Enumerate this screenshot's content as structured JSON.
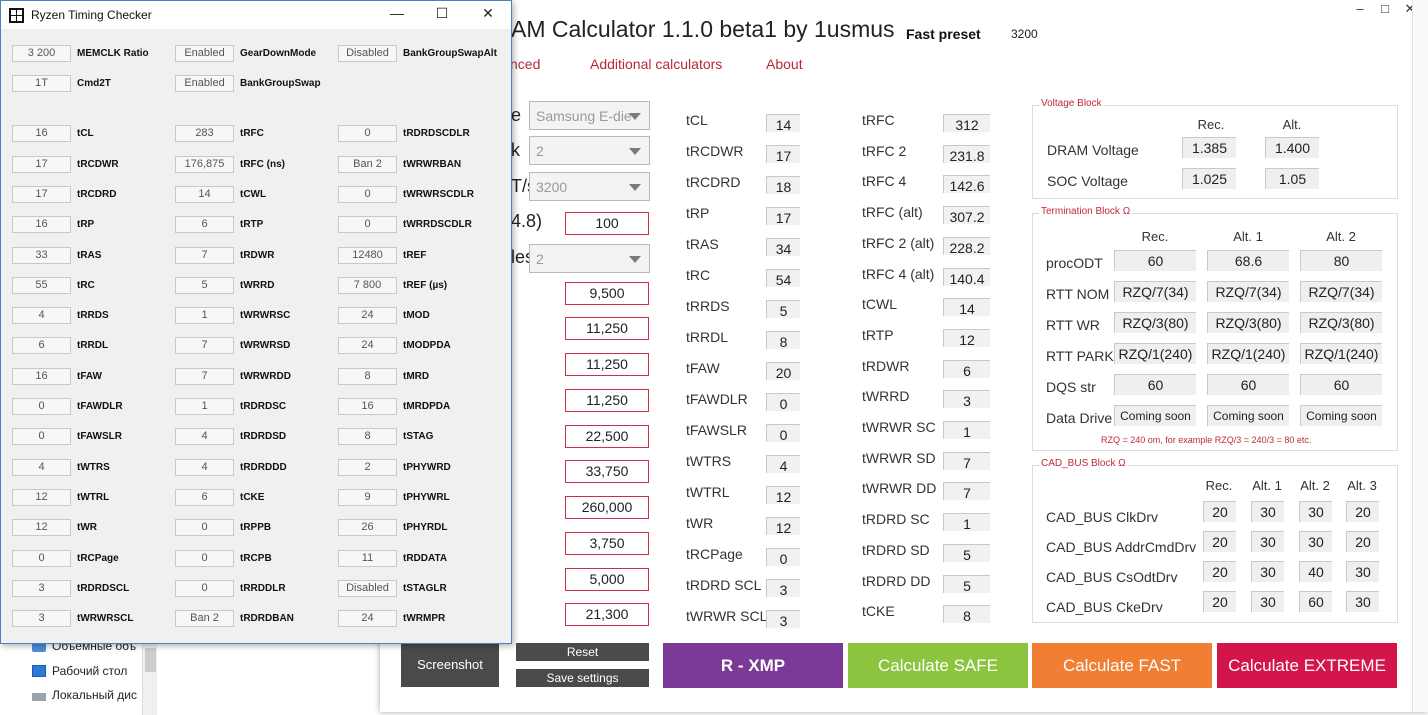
{
  "explorer": {
    "items": [
      "Объемные объ",
      "Рабочий стол",
      "Локальный дис"
    ]
  },
  "calculator": {
    "title": "AM Calculator 1.1.0 beta1 by 1usmus",
    "preset_label": "Fast preset",
    "preset_value": "3200",
    "window_buttons": [
      "–",
      "□",
      "✕"
    ],
    "nav": [
      "nced",
      "Additional calculators",
      "About"
    ],
    "left_labels": [
      "e",
      "k",
      "T/s)",
      "4.8)",
      "les"
    ],
    "combos": [
      "Samsung E-die",
      "2",
      "3200",
      "2"
    ],
    "red_values": [
      "100",
      "9,500",
      "11,250",
      "11,250",
      "11,250",
      "22,500",
      "33,750",
      "260,000",
      "3,750",
      "5,000",
      "21,300"
    ],
    "col1": [
      {
        "label": "tCL",
        "value": "14"
      },
      {
        "label": "tRCDWR",
        "value": "17"
      },
      {
        "label": "tRCDRD",
        "value": "18"
      },
      {
        "label": "tRP",
        "value": "17"
      },
      {
        "label": "tRAS",
        "value": "34"
      },
      {
        "label": "tRC",
        "value": "54"
      },
      {
        "label": "tRRDS",
        "value": "5"
      },
      {
        "label": "tRRDL",
        "value": "8"
      },
      {
        "label": "tFAW",
        "value": "20"
      },
      {
        "label": "tFAWDLR",
        "value": "0"
      },
      {
        "label": "tFAWSLR",
        "value": "0"
      },
      {
        "label": "tWTRS",
        "value": "4"
      },
      {
        "label": "tWTRL",
        "value": "12"
      },
      {
        "label": "tWR",
        "value": "12"
      },
      {
        "label": "tRCPage",
        "value": "0"
      },
      {
        "label": "tRDRD SCL",
        "value": "3"
      },
      {
        "label": "tWRWR SCL",
        "value": "3"
      }
    ],
    "col2": [
      {
        "label": "tRFC",
        "value": "312"
      },
      {
        "label": "tRFC 2",
        "value": "231.8"
      },
      {
        "label": "tRFC 4",
        "value": "142.6"
      },
      {
        "label": "tRFC (alt)",
        "value": "307.2"
      },
      {
        "label": "tRFC 2 (alt)",
        "value": "228.2"
      },
      {
        "label": "tRFC 4 (alt)",
        "value": "140.4"
      },
      {
        "label": "tCWL",
        "value": "14"
      },
      {
        "label": "tRTP",
        "value": "12"
      },
      {
        "label": "tRDWR",
        "value": "6"
      },
      {
        "label": "tWRRD",
        "value": "3"
      },
      {
        "label": "tWRWR SC",
        "value": "1"
      },
      {
        "label": "tWRWR SD",
        "value": "7"
      },
      {
        "label": "tWRWR DD",
        "value": "7"
      },
      {
        "label": "tRDRD SC",
        "value": "1"
      },
      {
        "label": "tRDRD SD",
        "value": "5"
      },
      {
        "label": "tRDRD DD",
        "value": "5"
      },
      {
        "label": "tCKE",
        "value": "8"
      }
    ],
    "voltage": {
      "title": "Voltage Block",
      "headers": [
        "Rec.",
        "Alt."
      ],
      "rows": [
        {
          "label": "DRAM Voltage",
          "values": [
            "1.385",
            "1.400"
          ]
        },
        {
          "label": "SOC Voltage",
          "values": [
            "1.025",
            "1.05"
          ]
        }
      ]
    },
    "termination": {
      "title": "Termination Block Ω",
      "headers": [
        "Rec.",
        "Alt. 1",
        "Alt. 2"
      ],
      "rows": [
        {
          "label": "procODT",
          "values": [
            "60",
            "68.6",
            "80"
          ]
        },
        {
          "label": "RTT NOM",
          "values": [
            "RZQ/7(34)",
            "RZQ/7(34)",
            "RZQ/7(34)"
          ]
        },
        {
          "label": "RTT WR",
          "values": [
            "RZQ/3(80)",
            "RZQ/3(80)",
            "RZQ/3(80)"
          ]
        },
        {
          "label": "RTT PARK",
          "values": [
            "RZQ/1(240)",
            "RZQ/1(240)",
            "RZQ/1(240)"
          ]
        },
        {
          "label": "DQS str",
          "values": [
            "60",
            "60",
            "60"
          ]
        },
        {
          "label": "Data Drive",
          "values": [
            "Coming soon",
            "Coming soon",
            "Coming soon"
          ]
        }
      ],
      "note": "RZQ = 240 om, for example RZQ/3 = 240/3 = 80 etc."
    },
    "cadbus": {
      "title": "CAD_BUS Block Ω",
      "headers": [
        "Rec.",
        "Alt. 1",
        "Alt. 2",
        "Alt. 3"
      ],
      "rows": [
        {
          "label": "CAD_BUS ClkDrv",
          "values": [
            "20",
            "30",
            "30",
            "20"
          ]
        },
        {
          "label": "CAD_BUS AddrCmdDrv",
          "values": [
            "20",
            "30",
            "30",
            "20"
          ]
        },
        {
          "label": "CAD_BUS CsOdtDrv",
          "values": [
            "20",
            "30",
            "40",
            "30"
          ]
        },
        {
          "label": "CAD_BUS CkeDrv",
          "values": [
            "20",
            "30",
            "60",
            "30"
          ]
        }
      ]
    },
    "buttons": {
      "screenshot": "Screenshot",
      "reset": "Reset",
      "save": "Save settings",
      "xmp": "R - XMP",
      "safe": "Calculate SAFE",
      "fast": "Calculate FAST",
      "extreme": "Calculate EXTREME"
    },
    "colors": {
      "accent": "#c0293b",
      "xmp": "#7b3a98",
      "safe": "#8cc43f",
      "fast": "#f07f33",
      "extreme": "#d4154b",
      "dark": "#4a4a4a"
    }
  },
  "rtc": {
    "title": "Ryzen Timing Checker",
    "window_buttons": [
      "—",
      "☐",
      "✕"
    ],
    "rows": [
      [
        {
          "v": "3 200",
          "l": "MEMCLK Ratio"
        },
        {
          "v": "Enabled",
          "l": "GearDownMode"
        },
        {
          "v": "Disabled",
          "l": "BankGroupSwapAlt"
        }
      ],
      [
        {
          "v": "1T",
          "l": "Cmd2T"
        },
        {
          "v": "Enabled",
          "l": "BankGroupSwap"
        },
        null
      ],
      [
        {
          "v": "16",
          "l": "tCL"
        },
        {
          "v": "283",
          "l": "tRFC"
        },
        {
          "v": "0",
          "l": "tRDRDSCDLR"
        }
      ],
      [
        {
          "v": "17",
          "l": "tRCDWR"
        },
        {
          "v": "176,875",
          "l": "tRFC (ns)"
        },
        {
          "v": "Ban 2",
          "l": "tWRWRBAN"
        }
      ],
      [
        {
          "v": "17",
          "l": "tRCDRD"
        },
        {
          "v": "14",
          "l": "tCWL"
        },
        {
          "v": "0",
          "l": "tWRWRSCDLR"
        }
      ],
      [
        {
          "v": "16",
          "l": "tRP"
        },
        {
          "v": "6",
          "l": "tRTP"
        },
        {
          "v": "0",
          "l": "tWRRDSCDLR"
        }
      ],
      [
        {
          "v": "33",
          "l": "tRAS"
        },
        {
          "v": "7",
          "l": "tRDWR"
        },
        {
          "v": "12480",
          "l": "tREF"
        }
      ],
      [
        {
          "v": "55",
          "l": "tRC"
        },
        {
          "v": "5",
          "l": "tWRRD"
        },
        {
          "v": "7 800",
          "l": "tREF (µs)"
        }
      ],
      [
        {
          "v": "4",
          "l": "tRRDS"
        },
        {
          "v": "1",
          "l": "tWRWRSC"
        },
        {
          "v": "24",
          "l": "tMOD"
        }
      ],
      [
        {
          "v": "6",
          "l": "tRRDL"
        },
        {
          "v": "7",
          "l": "tWRWRSD"
        },
        {
          "v": "24",
          "l": "tMODPDA"
        }
      ],
      [
        {
          "v": "16",
          "l": "tFAW"
        },
        {
          "v": "7",
          "l": "tWRWRDD"
        },
        {
          "v": "8",
          "l": "tMRD"
        }
      ],
      [
        {
          "v": "0",
          "l": "tFAWDLR"
        },
        {
          "v": "1",
          "l": "tRDRDSC"
        },
        {
          "v": "16",
          "l": "tMRDPDA"
        }
      ],
      [
        {
          "v": "0",
          "l": "tFAWSLR"
        },
        {
          "v": "4",
          "l": "tRDRDSD"
        },
        {
          "v": "8",
          "l": "tSTAG"
        }
      ],
      [
        {
          "v": "4",
          "l": "tWTRS"
        },
        {
          "v": "4",
          "l": "tRDRDDD"
        },
        {
          "v": "2",
          "l": "tPHYWRD"
        }
      ],
      [
        {
          "v": "12",
          "l": "tWTRL"
        },
        {
          "v": "6",
          "l": "tCKE"
        },
        {
          "v": "9",
          "l": "tPHYWRL"
        }
      ],
      [
        {
          "v": "12",
          "l": "tWR"
        },
        {
          "v": "0",
          "l": "tRPPB"
        },
        {
          "v": "26",
          "l": "tPHYRDL"
        }
      ],
      [
        {
          "v": "0",
          "l": "tRCPage"
        },
        {
          "v": "0",
          "l": "tRCPB"
        },
        {
          "v": "11",
          "l": "tRDDATA"
        }
      ],
      [
        {
          "v": "3",
          "l": "tRDRDSCL"
        },
        {
          "v": "0",
          "l": "tRRDDLR"
        },
        {
          "v": "Disabled",
          "l": "tSTAGLR"
        }
      ],
      [
        {
          "v": "3",
          "l": "tWRWRSCL"
        },
        {
          "v": "Ban 2",
          "l": "tRDRDBAN"
        },
        {
          "v": "24",
          "l": "tWRMPR"
        }
      ]
    ]
  }
}
